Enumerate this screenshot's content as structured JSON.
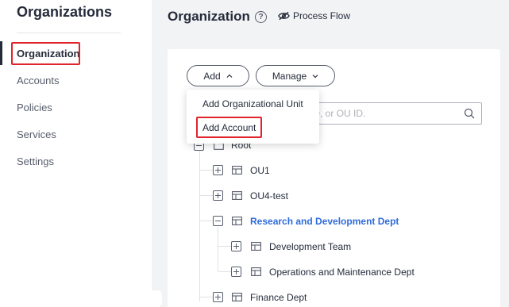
{
  "sidebar": {
    "title": "Organizations",
    "items": [
      {
        "label": "Organization",
        "active": true
      },
      {
        "label": "Accounts"
      },
      {
        "label": "Policies"
      },
      {
        "label": "Services"
      },
      {
        "label": "Settings"
      }
    ]
  },
  "header": {
    "title": "Organization",
    "help_icon": "help-circle-icon",
    "flow_link": "Process Flow",
    "flow_icon": "eye-off-icon"
  },
  "toolbar": {
    "add_label": "Add",
    "manage_label": "Manage"
  },
  "add_menu": {
    "items": [
      "Add Organizational Unit",
      "Add Account"
    ],
    "highlighted": "Add Account"
  },
  "search": {
    "placeholder_visible": "unt ID, or OU ID."
  },
  "tree": {
    "root": "Root",
    "nodes": [
      {
        "label": "OU1",
        "expanded": false
      },
      {
        "label": "OU4-test",
        "expanded": false
      },
      {
        "label": "Research and Development Dept",
        "expanded": true,
        "selected": true,
        "children": [
          {
            "label": "Development Team",
            "expanded": false
          },
          {
            "label": "Operations and Maintenance Dept",
            "expanded": false
          }
        ]
      },
      {
        "label": "Finance Dept",
        "expanded": false
      }
    ]
  },
  "colors": {
    "highlight": "#e0242b",
    "selected_text": "#2e6bdc",
    "background": "#f2f3f5",
    "text": "#252b3a"
  }
}
